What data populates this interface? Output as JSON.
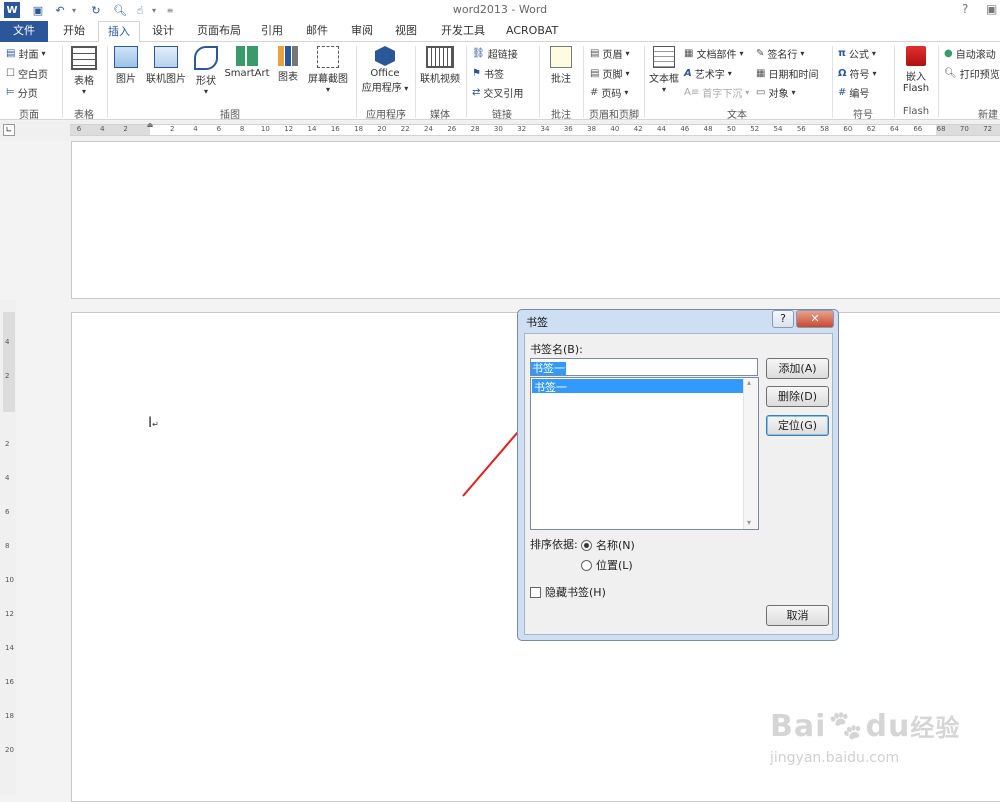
{
  "window": {
    "title": "word2013 - Word",
    "help": "?"
  },
  "tabs": [
    {
      "label": "文件",
      "active": false,
      "file": true
    },
    {
      "label": "开始"
    },
    {
      "label": "插入",
      "active": true
    },
    {
      "label": "设计"
    },
    {
      "label": "页面布局"
    },
    {
      "label": "引用"
    },
    {
      "label": "邮件"
    },
    {
      "label": "审阅"
    },
    {
      "label": "视图"
    },
    {
      "label": "开发工具"
    },
    {
      "label": "ACROBAT"
    }
  ],
  "ribbon": {
    "pages_group": {
      "items": [
        "封面",
        "空白页",
        "分页"
      ],
      "label": "页面"
    },
    "table_group": {
      "button": "表格",
      "label": "表格"
    },
    "illus_group": {
      "buttons": [
        "图片",
        "联机图片",
        "形状",
        "SmartArt",
        "图表",
        "屏幕截图"
      ],
      "label": "插图"
    },
    "apps_group": {
      "line1": "Office",
      "line2": "应用程序",
      "label": "应用程序"
    },
    "media_group": {
      "button": "联机视频",
      "label": "媒体"
    },
    "links_group": {
      "items": [
        "超链接",
        "书签",
        "交叉引用"
      ],
      "label": "链接"
    },
    "comment_group": {
      "button": "批注",
      "label": "批注"
    },
    "hf_group": {
      "items": [
        "页眉",
        "页脚",
        "页码"
      ],
      "label": "页眉和页脚"
    },
    "text_group": {
      "textbox": "文本框",
      "col1": [
        "文档部件",
        "艺术字",
        "首字下沉"
      ],
      "col2": [
        "签名行",
        "日期和时间",
        "对象"
      ],
      "label": "文本"
    },
    "symbol_group": {
      "items": [
        "公式",
        "符号",
        "编号"
      ],
      "label": "符号"
    },
    "flash_group": {
      "line1": "嵌入",
      "line2": "Flash",
      "label": "Flash"
    },
    "new_group": {
      "items": [
        "自动滚动",
        "打印预览"
      ],
      "label": "新建"
    }
  },
  "ruler": {
    "numbers": [
      "6",
      "4",
      "2",
      "",
      "2",
      "4",
      "6",
      "8",
      "10",
      "12",
      "14",
      "16",
      "18",
      "20",
      "22",
      "24",
      "26",
      "28",
      "30",
      "32",
      "34",
      "36",
      "38",
      "40",
      "42",
      "44",
      "46",
      "48",
      "50",
      "52",
      "54",
      "56",
      "58",
      "60",
      "62",
      "64",
      "66",
      "68",
      "70",
      "72"
    ]
  },
  "vruler": {
    "numbers": [
      "4",
      "2",
      "",
      "2",
      "4",
      "6",
      "8",
      "10",
      "12",
      "14",
      "16",
      "18",
      "20"
    ]
  },
  "dialog": {
    "title": "书签",
    "name_label": "书签名(B):",
    "name_value": "书签一",
    "list": [
      "书签一"
    ],
    "add": "添加(A)",
    "delete": "删除(D)",
    "goto": "定位(G)",
    "sort_label": "排序依据:",
    "sort_name": "名称(N)",
    "sort_position": "位置(L)",
    "hidden": "隐藏书签(H)",
    "cancel": "取消",
    "help": "?",
    "close": "✕"
  },
  "watermark": {
    "brand": "Bai",
    "brand2": "du",
    "cn": "经验",
    "url": "jingyan.baidu.com"
  },
  "colors": {
    "file_tab": "#2b579a",
    "accent": "#2b579a",
    "arrow": "#e02020",
    "selection": "#3399ff"
  }
}
